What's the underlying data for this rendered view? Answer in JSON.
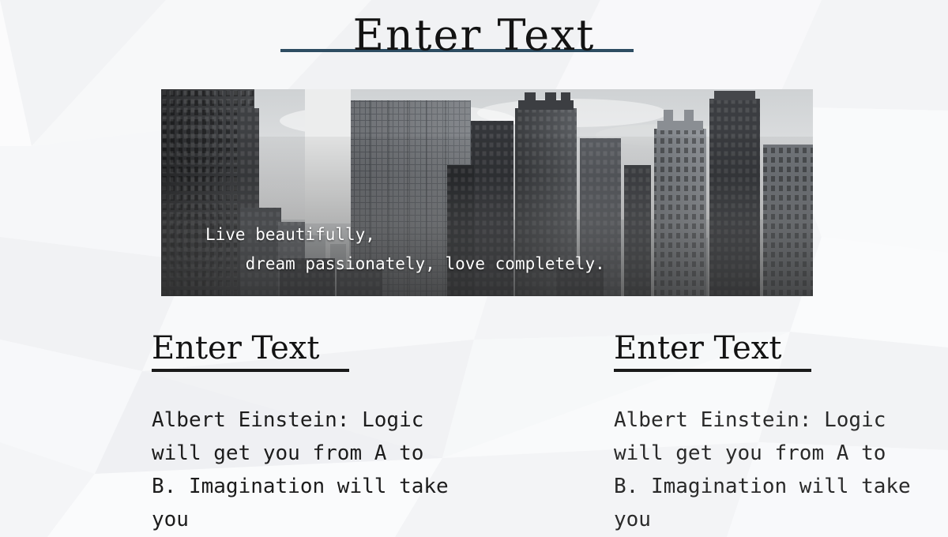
{
  "slide": {
    "title": "Enter Text",
    "accent_rule_color": "#2e4d62",
    "heading_rule_color": "#1a1a1a",
    "background_color": "#fafafb"
  },
  "hero": {
    "image_name": "city-skyline-grayscale-photo",
    "caption": "Live beautifully,\n    dream passionately, love completely."
  },
  "columns": [
    {
      "heading": "Enter Text",
      "body": "Albert Einstein: Logic will get you from A to B. Imagination will take you"
    },
    {
      "heading": "Enter Text",
      "body": "Albert Einstein: Logic will get you from A to B. Imagination will take you"
    }
  ]
}
